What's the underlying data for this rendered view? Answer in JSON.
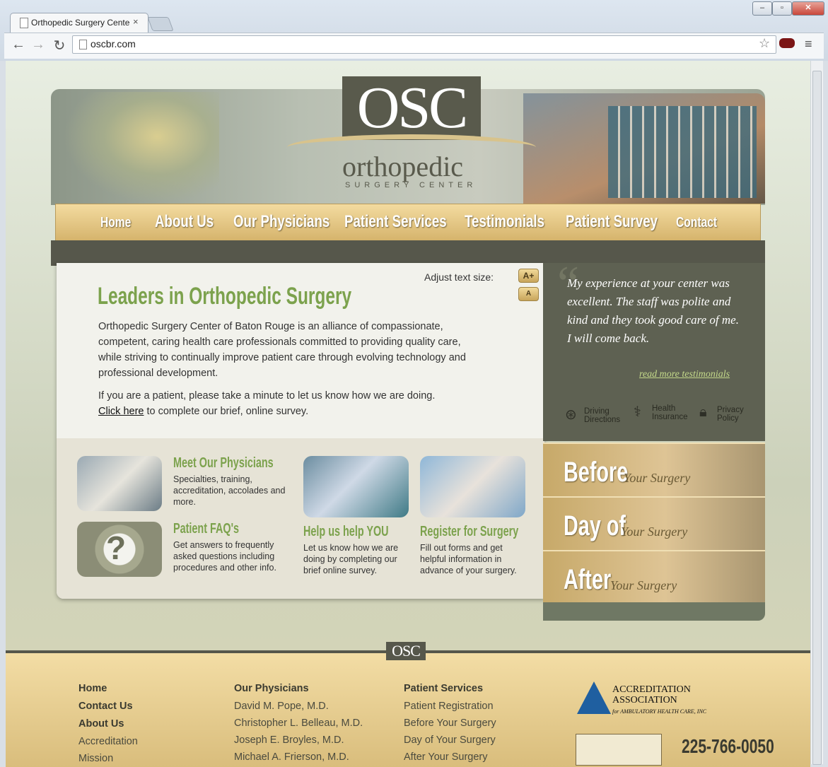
{
  "browser": {
    "tab_title": "Orthopedic Surgery Cente",
    "url": "oscbr.com",
    "back": "←",
    "forward": "→",
    "reload": "↻",
    "star": "☆",
    "menu": "≡",
    "tab_close": "×",
    "min": "–",
    "max": "▫",
    "close": "✕"
  },
  "logo": {
    "mark": "OSC",
    "word": "orthopedic",
    "sub": "SURGERY CENTER"
  },
  "nav": [
    "Home",
    "About Us",
    "Our Physicians",
    "Patient Services",
    "Testimonials",
    "Patient Survey",
    "Contact"
  ],
  "text_size": {
    "label": "Adjust text size:",
    "increase": "A+",
    "decrease": "A"
  },
  "main": {
    "heading": "Leaders in Orthopedic Surgery",
    "intro": "Orthopedic Surgery Center of Baton Rouge is an alliance of compassionate, competent, caring health care professionals committed to providing quality care, while striving to continually improve patient care through evolving technology and professional development.",
    "survey_text": "If you are a patient, please take a minute to let us know how we are doing.",
    "click_here": "Click here",
    "survey_tail": " to complete our brief, online survey."
  },
  "features": [
    {
      "title": "Meet Our Physicians",
      "desc": "Specialties, training, accreditation, accolades and more."
    },
    {
      "title": "Patient FAQ's",
      "desc": "Get answers to frequently asked questions including procedures and other info."
    },
    {
      "title": "Help us help YOU",
      "desc": "Let us know how we are doing by completing our brief online survey."
    },
    {
      "title": "Register for Surgery",
      "desc": "Fill out forms and get helpful information in advance of your surgery."
    }
  ],
  "testimonial": {
    "quote": "My experience at your center was excellent. The staff was polite and kind and they took good care of me. I will come back.",
    "read_more": "read more testimonials"
  },
  "utilities": [
    {
      "label1": "Driving",
      "label2": "Directions",
      "icon": "steering-wheel-icon"
    },
    {
      "label1": "Health",
      "label2": "Insurance",
      "icon": "caduceus-icon"
    },
    {
      "label1": "Privacy",
      "label2": "Policy",
      "icon": "lock-icon"
    }
  ],
  "surgery_tiles": [
    {
      "big": "Before",
      "small": "Your Surgery"
    },
    {
      "big": "Day of",
      "small": "Your Surgery"
    },
    {
      "big": "After",
      "small": "Your Surgery"
    }
  ],
  "footer": {
    "logo": "OSC",
    "col1": [
      "Home",
      "Contact Us",
      "About Us",
      "Accreditation",
      "Mission"
    ],
    "col2_head": "Our Physicians",
    "col2": [
      "David M. Pope, M.D.",
      "Christopher L. Belleau, M.D.",
      "Joseph E. Broyles, M.D.",
      "Michael A. Frierson, M.D."
    ],
    "col3_head": "Patient Services",
    "col3": [
      "Patient Registration",
      "Before Your Surgery",
      "Day of Your Surgery",
      "After Your Surgery"
    ],
    "accreditation_line1": "ACCREDITATION",
    "accreditation_line2": "ASSOCIATION",
    "accreditation_sub": "for AMBULATORY HEALTH CARE, INC",
    "phone": "225-766-0050"
  }
}
